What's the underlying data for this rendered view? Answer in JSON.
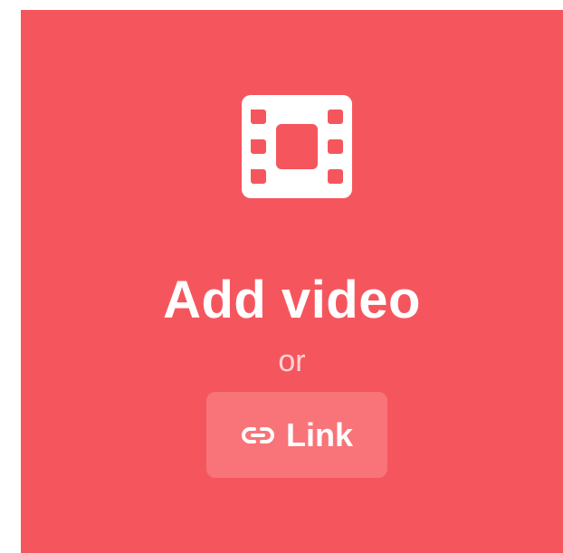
{
  "upload": {
    "icon": "film-icon",
    "title": "Add video",
    "separator": "or",
    "link_button": {
      "icon": "link-icon",
      "label": "Link"
    }
  },
  "colors": {
    "panel_background": "#f5565e",
    "button_background": "#f87479",
    "text": "#ffffff",
    "muted_text": "#fbd3d5"
  }
}
